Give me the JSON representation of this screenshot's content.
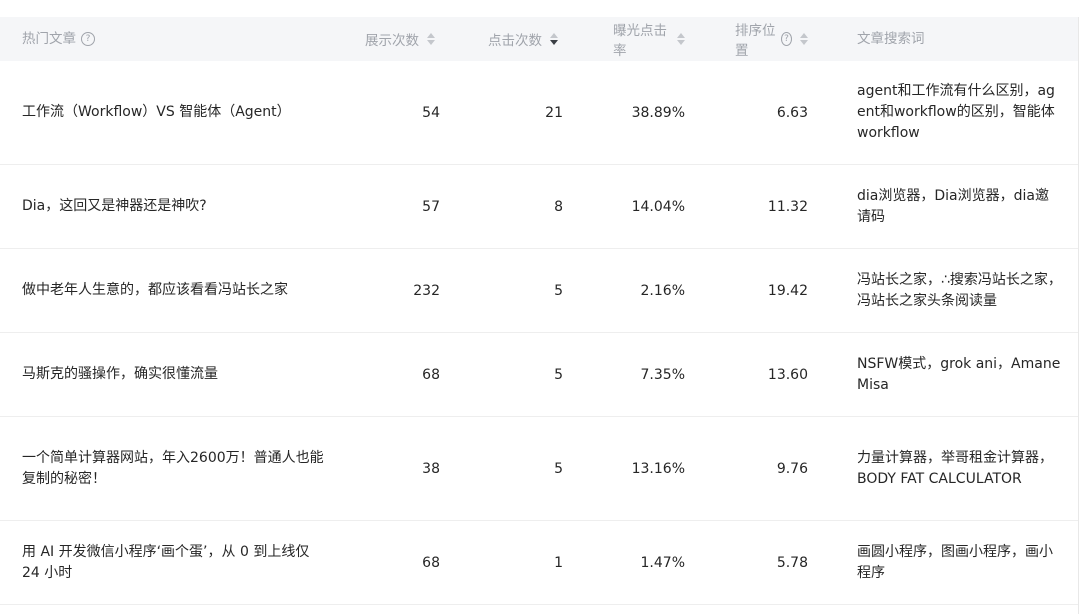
{
  "table": {
    "headers": {
      "title": "热门文章",
      "impressions": "展示次数",
      "clicks": "点击次数",
      "ctr": "曝光点击率",
      "position": "排序位置",
      "keywords": "文章搜索词"
    },
    "icons": {
      "help": "question-circle-icon",
      "sort": "sort-caret-icon"
    },
    "active_sort": "clicks-desc",
    "rows": [
      {
        "title": "工作流（Workflow）VS 智能体（Agent）",
        "impressions": "54",
        "clicks": "21",
        "ctr": "38.89%",
        "position": "6.63",
        "keywords": "agent和工作流有什么区别，agent和workflow的区别，智能体workflow"
      },
      {
        "title": "Dia，这回又是神器还是神吹?",
        "impressions": "57",
        "clicks": "8",
        "ctr": "14.04%",
        "position": "11.32",
        "keywords": "dia浏览器，Dia浏览器，dia邀请码"
      },
      {
        "title": "做中老年人生意的，都应该看看冯站长之家",
        "impressions": "232",
        "clicks": "5",
        "ctr": "2.16%",
        "position": "19.42",
        "keywords": "冯站长之家，∴搜索冯站长之家，冯站长之家头条阅读量"
      },
      {
        "title": "马斯克的骚操作，确实很懂流量",
        "impressions": "68",
        "clicks": "5",
        "ctr": "7.35%",
        "position": "13.60",
        "keywords": "NSFW模式，grok ani，Amane Misa"
      },
      {
        "title": "一个简单计算器网站，年入2600万！普通人也能复制的秘密！",
        "impressions": "38",
        "clicks": "5",
        "ctr": "13.16%",
        "position": "9.76",
        "keywords": "力量计算器，举哥租金计算器，BODY FAT CALCULATOR"
      },
      {
        "title": "用 AI 开发微信小程序‘画个蛋’，从 0 到上线仅 24 小时",
        "impressions": "68",
        "clicks": "1",
        "ctr": "1.47%",
        "position": "5.78",
        "keywords": "画圆小程序，图画小程序，画小程序"
      }
    ]
  }
}
